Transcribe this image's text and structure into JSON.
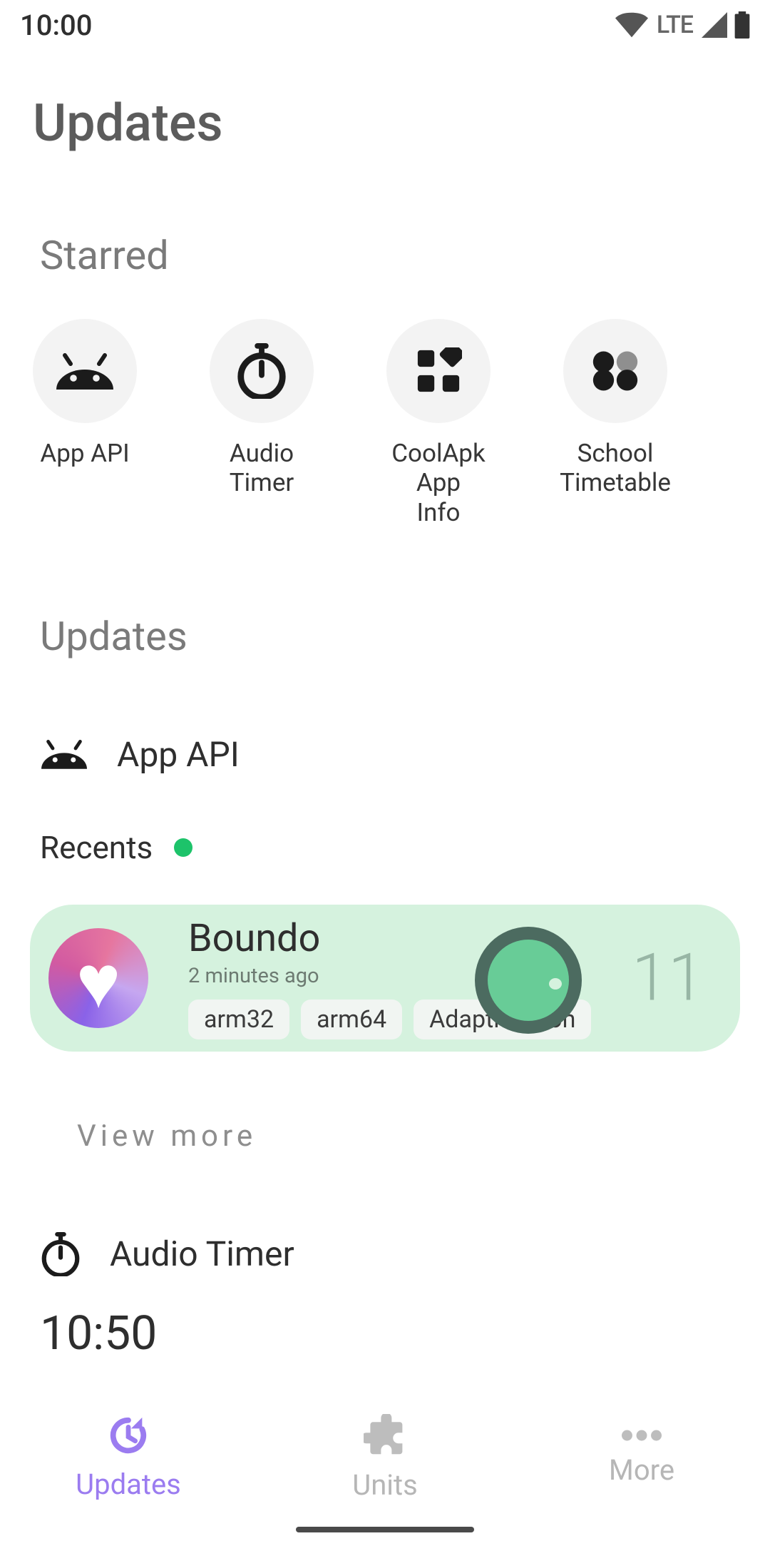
{
  "status": {
    "time": "10:00",
    "network": "LTE"
  },
  "page_title": "Updates",
  "sections": {
    "starred": "Starred",
    "updates": "Updates"
  },
  "starred": [
    {
      "label": "App API",
      "icon": "android"
    },
    {
      "label": "Audio Timer",
      "icon": "stopwatch"
    },
    {
      "label": "CoolApk App\nInfo",
      "icon": "widgets"
    },
    {
      "label": "School\nTimetable",
      "icon": "fourdots"
    }
  ],
  "app_api": {
    "title": "App API",
    "recents_label": "Recents",
    "card": {
      "name": "Boundo",
      "subtitle": "2 minutes ago",
      "tags": [
        "arm32",
        "arm64",
        "Adaptive icon"
      ],
      "api_level": "11"
    },
    "view_more": "View more"
  },
  "audio_timer": {
    "title": "Audio Timer",
    "value": "10:50"
  },
  "nav": [
    {
      "label": "Updates",
      "icon": "clock-refresh",
      "active": true
    },
    {
      "label": "Units",
      "icon": "puzzle",
      "active": false
    },
    {
      "label": "More",
      "icon": "dots",
      "active": false
    }
  ],
  "colors": {
    "accent": "#9b7cf0",
    "card_bg": "#d5f2de",
    "green_dot": "#1dc36a"
  }
}
